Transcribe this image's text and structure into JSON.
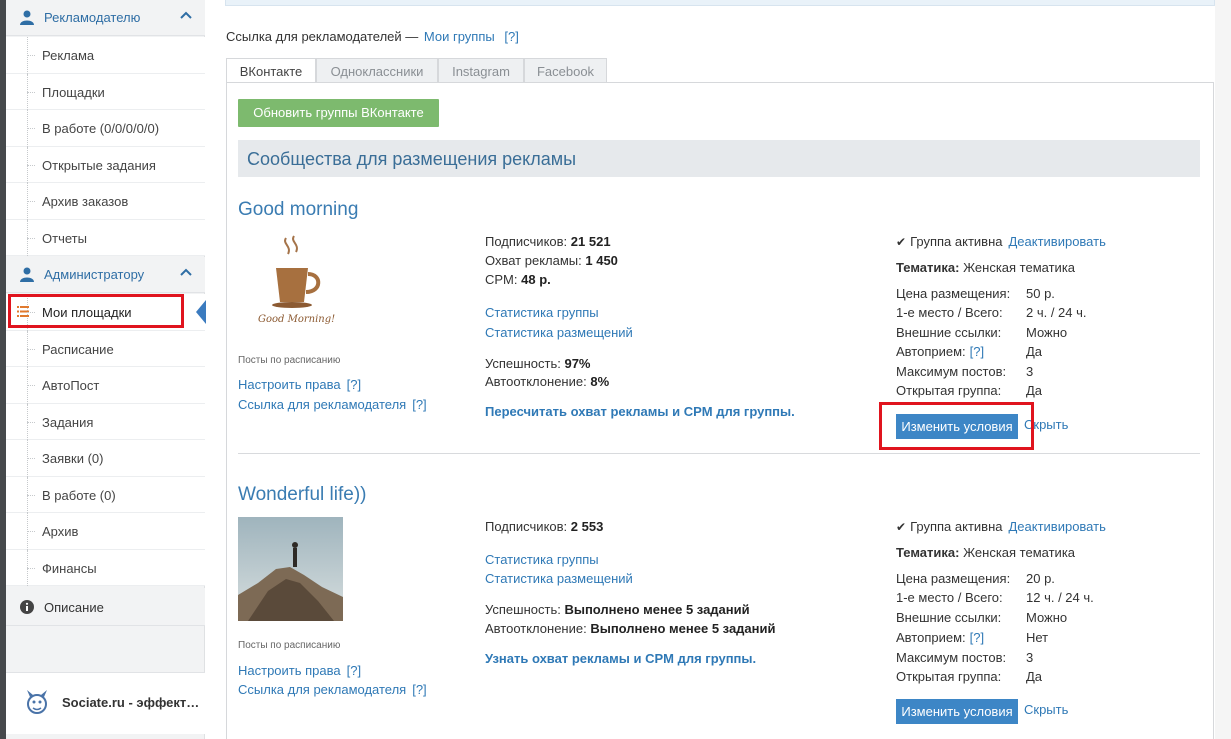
{
  "sidebar": {
    "advertiser": {
      "title": "Рекламодателю"
    },
    "advertiser_items": [
      "Реклама",
      "Площадки",
      "В работе (0/0/0/0/0)",
      "Открытые задания",
      "Архив заказов",
      "Отчеты"
    ],
    "admin": {
      "title": "Администратору"
    },
    "admin_items": [
      "Мои площадки",
      "Расписание",
      "АвтоПост",
      "Задания",
      "Заявки (0)",
      "В работе (0)",
      "Архив",
      "Финансы"
    ],
    "description": "Описание",
    "footer": "Sociate.ru - эффект…"
  },
  "main": {
    "link_prefix": "Ссылка для рекламодателей —",
    "link_label": "Мои группы",
    "link_help": "[?]",
    "tabs": [
      "ВКонтакте",
      "Одноклассники",
      "Instagram",
      "Facebook"
    ],
    "refresh_button": "Обновить группы ВКонтакте",
    "section_title": "Сообщества для размещения рекламы"
  },
  "groups": [
    {
      "name": "Good morning",
      "thumb_text": "Good Morning!",
      "schedule_note": "Посты по расписанию",
      "rights_link": "Настроить права",
      "adv_link": "Ссылка для рекламодателя",
      "help": "[?]",
      "subs_label": "Подписчиков:",
      "subs": "21 521",
      "reach_label": "Охват рекламы:",
      "reach": "1 450",
      "cpm_label": "CPM:",
      "cpm": "48 р.",
      "stat_group": "Статистика группы",
      "stat_place": "Статистика размещений",
      "success_label": "Успешность:",
      "success": "97%",
      "autoreject_label": "Автоотклонение:",
      "autoreject": "8%",
      "action_link": "Пересчитать охват рекламы и CPM для группы.",
      "active_text": "Группа активна",
      "deactivate": "Деактивировать",
      "topic_label": "Тематика:",
      "topic": "Женская тематика",
      "conditions": [
        {
          "k": "Цена размещения:",
          "v": "50 р."
        },
        {
          "k": "1-е место / Всего:",
          "v": "2 ч. / 24 ч."
        },
        {
          "k": "Внешние ссылки:",
          "v": "Можно"
        },
        {
          "k": "Автоприем:",
          "help": "[?]",
          "v": "Да"
        },
        {
          "k": "Максимум постов:",
          "v": "3"
        },
        {
          "k": "Открытая группа:",
          "v": "Да"
        }
      ],
      "change_button": "Изменить условия",
      "hide": "Скрыть"
    },
    {
      "name": "Wonderful life))",
      "schedule_note": "Посты по расписанию",
      "rights_link": "Настроить права",
      "adv_link": "Ссылка для рекламодателя",
      "help": "[?]",
      "subs_label": "Подписчиков:",
      "subs": "2 553",
      "stat_group": "Статистика группы",
      "stat_place": "Статистика размещений",
      "success_label": "Успешность:",
      "success": "Выполнено менее 5 заданий",
      "autoreject_label": "Автоотклонение:",
      "autoreject": "Выполнено менее 5 заданий",
      "action_link": "Узнать охват рекламы и CPM для группы.",
      "active_text": "Группа активна",
      "deactivate": "Деактивировать",
      "topic_label": "Тематика:",
      "topic": "Женская тематика",
      "conditions": [
        {
          "k": "Цена размещения:",
          "v": "20 р."
        },
        {
          "k": "1-е место / Всего:",
          "v": "12 ч. / 24 ч."
        },
        {
          "k": "Внешние ссылки:",
          "v": "Можно"
        },
        {
          "k": "Автоприем:",
          "help": "[?]",
          "v": "Нет"
        },
        {
          "k": "Максимум постов:",
          "v": "3"
        },
        {
          "k": "Открытая группа:",
          "v": "Да"
        }
      ],
      "change_button": "Изменить условия",
      "hide": "Скрыть"
    }
  ],
  "colors": {
    "accent": "#2f79b6",
    "green_button": "#7dba6e",
    "blue_button": "#3d86c6",
    "highlight": "#e0141e"
  }
}
